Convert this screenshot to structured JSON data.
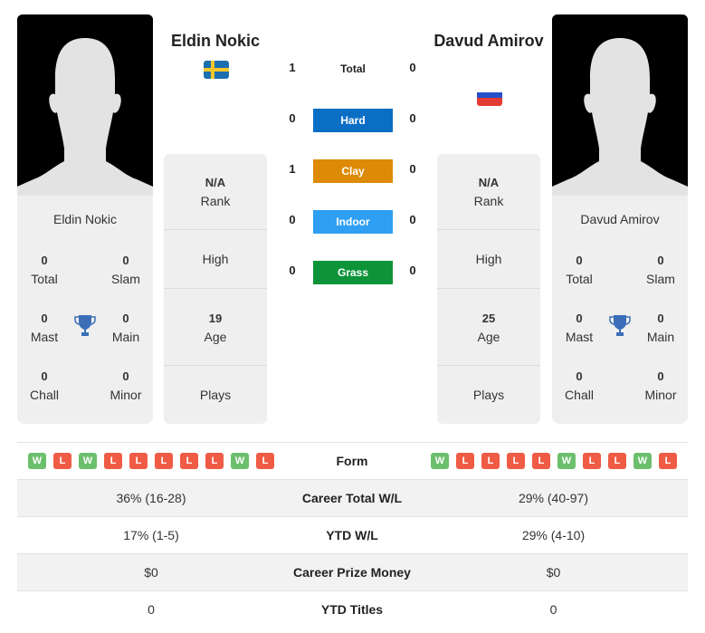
{
  "player1": {
    "name": "Eldin Nokic",
    "country_flag": "sweden-flag",
    "card_name": "Eldin Nokic",
    "titles": {
      "total": {
        "value": "0",
        "label": "Total"
      },
      "slam": {
        "value": "0",
        "label": "Slam"
      },
      "mast": {
        "value": "0",
        "label": "Mast"
      },
      "main": {
        "value": "0",
        "label": "Main"
      },
      "chall": {
        "value": "0",
        "label": "Chall"
      },
      "minor": {
        "value": "0",
        "label": "Minor"
      }
    },
    "rank": {
      "value": "N/A",
      "label": "Rank"
    },
    "high": {
      "label": "High"
    },
    "age": {
      "value": "19",
      "label": "Age"
    },
    "plays": {
      "label": "Plays"
    },
    "form": [
      "W",
      "L",
      "W",
      "L",
      "L",
      "L",
      "L",
      "L",
      "W",
      "L"
    ]
  },
  "player2": {
    "name": "Davud Amirov",
    "country_flag": "russia-flag",
    "card_name": "Davud Amirov",
    "titles": {
      "total": {
        "value": "0",
        "label": "Total"
      },
      "slam": {
        "value": "0",
        "label": "Slam"
      },
      "mast": {
        "value": "0",
        "label": "Mast"
      },
      "main": {
        "value": "0",
        "label": "Main"
      },
      "chall": {
        "value": "0",
        "label": "Chall"
      },
      "minor": {
        "value": "0",
        "label": "Minor"
      }
    },
    "rank": {
      "value": "N/A",
      "label": "Rank"
    },
    "high": {
      "label": "High"
    },
    "age": {
      "value": "25",
      "label": "Age"
    },
    "plays": {
      "label": "Plays"
    },
    "form": [
      "W",
      "L",
      "L",
      "L",
      "L",
      "W",
      "L",
      "L",
      "W",
      "L"
    ]
  },
  "h2h": {
    "total": {
      "label": "Total",
      "p1": "1",
      "p2": "0"
    },
    "surfaces": [
      {
        "label": "Hard",
        "p1": "0",
        "p2": "0",
        "color": "#0b6ec5"
      },
      {
        "label": "Clay",
        "p1": "1",
        "p2": "0",
        "color": "#dd8a06"
      },
      {
        "label": "Indoor",
        "p1": "0",
        "p2": "0",
        "color": "#2e9ff3"
      },
      {
        "label": "Grass",
        "p1": "0",
        "p2": "0",
        "color": "#0d9439"
      }
    ]
  },
  "comparison": {
    "form_label": "Form",
    "rows": [
      {
        "label": "Career Total W/L",
        "p1": "36% (16-28)",
        "p2": "29% (40-97)"
      },
      {
        "label": "YTD W/L",
        "p1": "17% (1-5)",
        "p2": "29% (4-10)"
      },
      {
        "label": "Career Prize Money",
        "p1": "$0",
        "p2": "$0"
      },
      {
        "label": "YTD Titles",
        "p1": "0",
        "p2": "0"
      }
    ]
  },
  "colors": {
    "win": "#6cbf6c",
    "loss": "#ef5b45",
    "trophy": "#3a6fb8"
  }
}
